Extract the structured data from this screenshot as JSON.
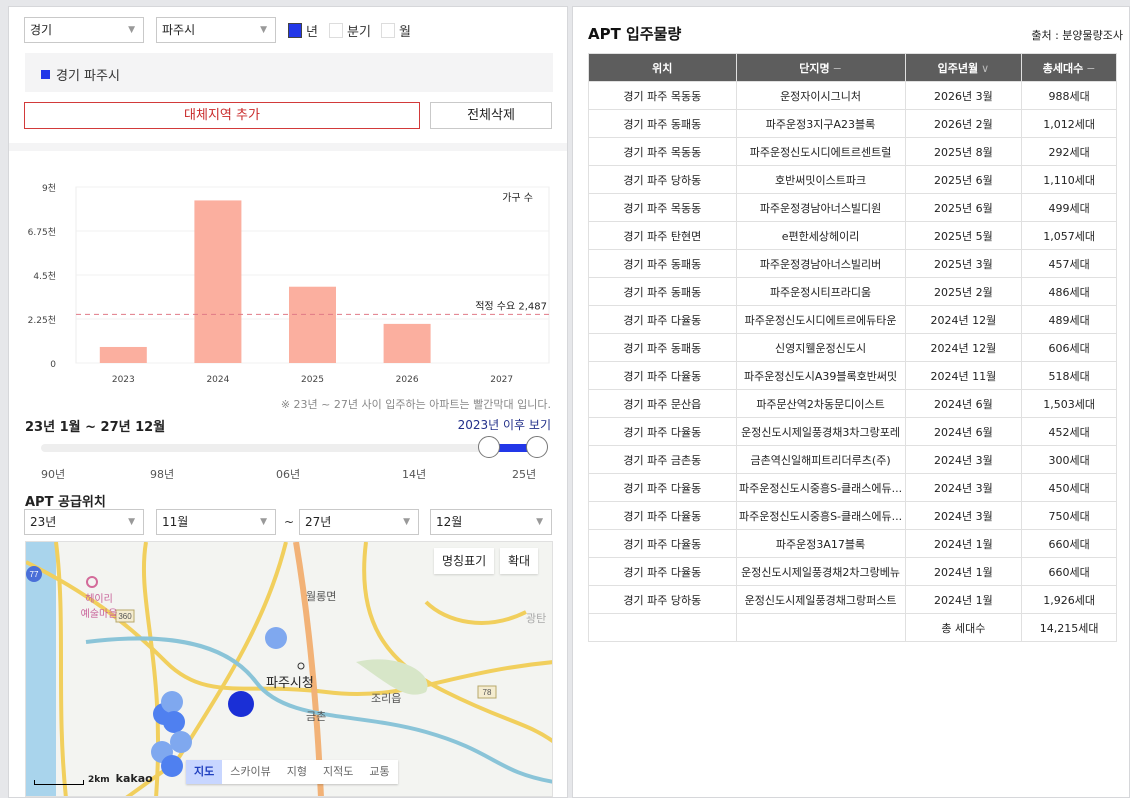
{
  "filters": {
    "province": "경기",
    "city": "파주시",
    "period_options": [
      {
        "label": "년",
        "checked": true
      },
      {
        "label": "분기",
        "checked": false
      },
      {
        "label": "월",
        "checked": false
      }
    ]
  },
  "selected_region": {
    "label": "경기 파주시",
    "color": "#2237e8"
  },
  "buttons": {
    "add_alt_region": "대체지역 추가",
    "delete_all": "전체삭제"
  },
  "chart_data": {
    "type": "bar",
    "categories": [
      "2023",
      "2024",
      "2025",
      "2026",
      "2027"
    ],
    "values": [
      820,
      8314,
      3901,
      2000,
      0
    ],
    "series_name": "가구 수",
    "ylim": [
      0,
      9000
    ],
    "yticks": [
      0,
      2250,
      4500,
      6750,
      9000
    ],
    "ytick_labels": [
      "0",
      "2.25천",
      "4.5천",
      "6.75천",
      "9천"
    ],
    "reference_line": {
      "label": "적정 수요 2,487",
      "value": 2487
    },
    "bar_color": "#fbaf9f",
    "reference_color": "#e07a86",
    "grid": true,
    "legend": "top-right"
  },
  "chart_note": "※ 23년 ~ 27년 사이 입주하는 아파트는 빨간막대 입니다.",
  "range": {
    "title": "23년 1월 ~ 27년 12월",
    "link": "2023년 이후 보기",
    "ticks": [
      "90년",
      "98년",
      "06년",
      "14년",
      "25년"
    ],
    "start_fraction": 0.903,
    "end_fraction": 1.0,
    "accent": "#2237e8"
  },
  "supply": {
    "title": "APT 공급위치",
    "from_year": "23년",
    "from_month": "11월",
    "to_year": "27년",
    "to_month": "12월",
    "tilde": "~"
  },
  "map": {
    "buttons": {
      "labels": "명칭표기",
      "zoom": "확대"
    },
    "types": [
      "지도",
      "스카이뷰",
      "지형",
      "지적도",
      "교통"
    ],
    "active_type": "지도",
    "place_labels": [
      "파주시청",
      "헤이리\n예술마을",
      "월롱면",
      "조리읍",
      "금촌",
      "광탄"
    ],
    "road_badges": [
      "77",
      "360",
      "78"
    ],
    "scale": "2km",
    "brand": "kakao"
  },
  "table": {
    "title": "APT 입주물량",
    "source": "출처 : 분양물량조사",
    "headers": [
      {
        "label": "위치",
        "sort": ""
      },
      {
        "label": "단지명",
        "sort": "−"
      },
      {
        "label": "입주년월",
        "sort": "∨"
      },
      {
        "label": "총세대수",
        "sort": "−"
      }
    ],
    "rows": [
      [
        "경기 파주 목동동",
        "운정자이시그니처",
        "2026년 3월",
        "988세대"
      ],
      [
        "경기 파주 동패동",
        "파주운정3지구A23블록",
        "2026년 2월",
        "1,012세대"
      ],
      [
        "경기 파주 목동동",
        "파주운정신도시디에트르센트럴",
        "2025년 8월",
        "292세대"
      ],
      [
        "경기 파주 당하동",
        "호반써밋이스트파크",
        "2025년 6월",
        "1,110세대"
      ],
      [
        "경기 파주 목동동",
        "파주운정경남아너스빌디원",
        "2025년 6월",
        "499세대"
      ],
      [
        "경기 파주 탄현면",
        "e편한세상헤이리",
        "2025년 5월",
        "1,057세대"
      ],
      [
        "경기 파주 동패동",
        "파주운정경남아너스빌리버",
        "2025년 3월",
        "457세대"
      ],
      [
        "경기 파주 동패동",
        "파주운정시티프라디움",
        "2025년 2월",
        "486세대"
      ],
      [
        "경기 파주 다율동",
        "파주운정신도시디에트르에듀타운",
        "2024년 12월",
        "489세대"
      ],
      [
        "경기 파주 동패동",
        "신영지웰운정신도시",
        "2024년 12월",
        "606세대"
      ],
      [
        "경기 파주 다율동",
        "파주운정신도시A39블록호반써밋",
        "2024년 11월",
        "518세대"
      ],
      [
        "경기 파주 문산읍",
        "파주문산역2차동문디이스트",
        "2024년 6월",
        "1,503세대"
      ],
      [
        "경기 파주 다율동",
        "운정신도시제일풍경채3차그랑포레",
        "2024년 6월",
        "452세대"
      ],
      [
        "경기 파주 금촌동",
        "금촌역신일해피트리더루츠(주)",
        "2024년 3월",
        "300세대"
      ],
      [
        "경기 파주 다율동",
        "파주운정신도시중흥S-클래스에듀...",
        "2024년 3월",
        "450세대"
      ],
      [
        "경기 파주 다율동",
        "파주운정신도시중흥S-클래스에듀...",
        "2024년 3월",
        "750세대"
      ],
      [
        "경기 파주 다율동",
        "파주운정3A17블록",
        "2024년 1월",
        "660세대"
      ],
      [
        "경기 파주 다율동",
        "운정신도시제일풍경채2차그랑베뉴",
        "2024년 1월",
        "660세대"
      ],
      [
        "경기 파주 당하동",
        "운정신도시제일풍경채그랑퍼스트",
        "2024년 1월",
        "1,926세대"
      ]
    ],
    "total_label": "총 세대수",
    "total_value": "14,215세대"
  }
}
